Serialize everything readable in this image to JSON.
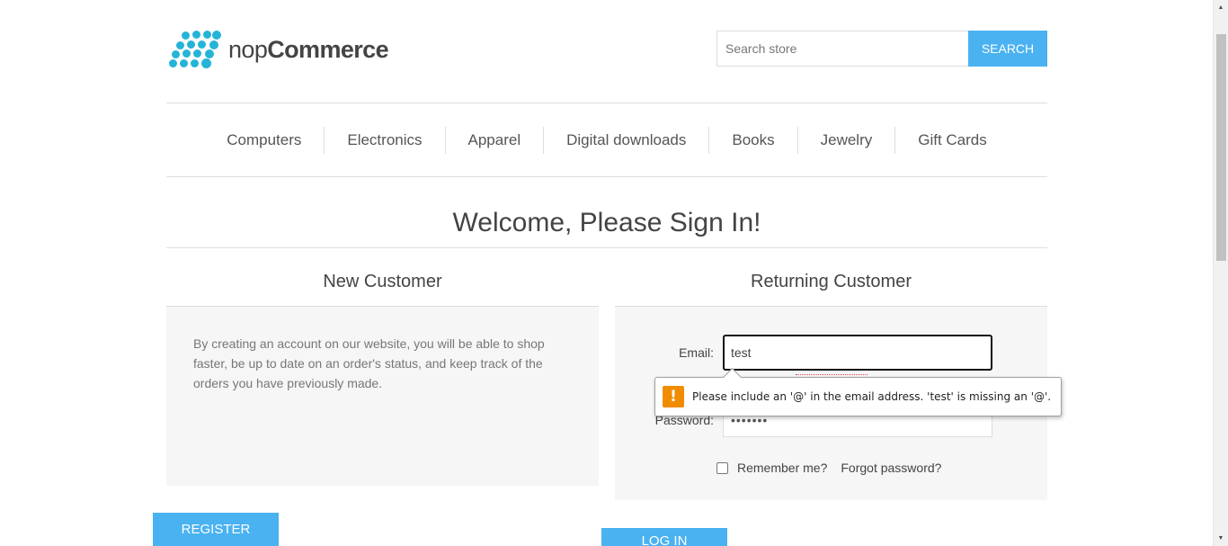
{
  "header": {
    "logo": {
      "text_light": "nop",
      "text_bold": "Commerce"
    },
    "search": {
      "placeholder": "Search store",
      "button_label": "SEARCH"
    }
  },
  "nav": {
    "items": [
      {
        "label": "Computers"
      },
      {
        "label": "Electronics"
      },
      {
        "label": "Apparel"
      },
      {
        "label": "Digital downloads"
      },
      {
        "label": "Books"
      },
      {
        "label": "Jewelry"
      },
      {
        "label": "Gift Cards"
      }
    ]
  },
  "page_title": "Welcome, Please Sign In!",
  "new_customer": {
    "title": "New Customer",
    "text": "By creating an account on our website, you will be able to shop faster, be up to date on an order's status, and keep track of the orders you have previously made.",
    "register_label": "REGISTER"
  },
  "returning_customer": {
    "title": "Returning Customer",
    "email_label": "Email:",
    "email_value": "test",
    "password_label": "Password:",
    "password_value": "•••••••",
    "remember_label": "Remember me?",
    "remember_checked": false,
    "forgot_label": "Forgot password?",
    "login_label": "LOG IN"
  },
  "validation_tooltip": {
    "icon": "warning-icon",
    "text": "Please include an '@' in the email address. 'test' is missing an '@'."
  },
  "colors": {
    "accent": "#4ab2f1",
    "logo_dots": "#26b3d8",
    "warning": "#f08c00"
  }
}
